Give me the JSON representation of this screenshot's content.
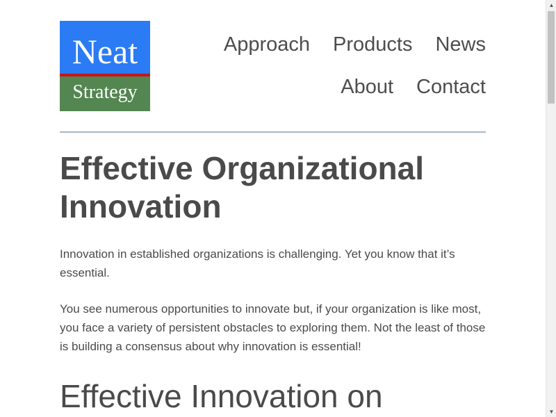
{
  "logo": {
    "top_text": "Neat",
    "bottom_text": "Strategy",
    "colors": {
      "top": "#2b7bf4",
      "stripe": "#c8141b",
      "bottom": "#538650"
    }
  },
  "nav": {
    "row1": [
      "Approach",
      "Products",
      "News"
    ],
    "row2": [
      "About",
      "Contact"
    ]
  },
  "main": {
    "title": "Effective Organizational Innovation",
    "paragraph1": "Innovation in established organizations is challenging. Yet you know that it’s essential.",
    "paragraph2": "You see numerous opportunities to innovate but, if your organization is like most, you face a variety of persistent obstacles to exploring them.  Not the least of those is building a consensus about why innovation is essential!",
    "subheading": "Effective Innovation on"
  },
  "scrollbar": {
    "up_icon": "arrow-up-icon",
    "down_icon": "arrow-down-icon"
  }
}
